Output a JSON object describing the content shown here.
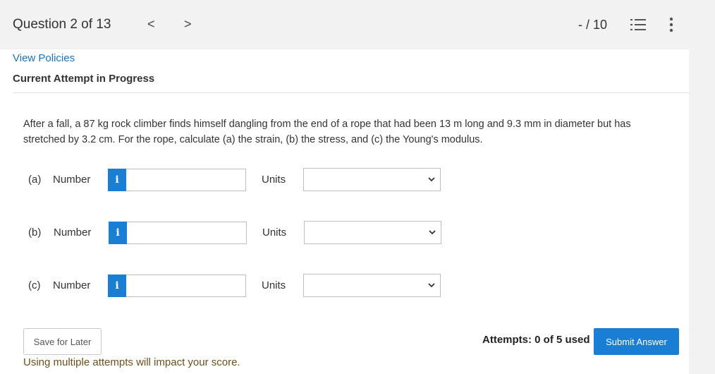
{
  "header": {
    "question_counter": "Question 2 of 13",
    "prev_label": "<",
    "next_label": ">",
    "score": "- / 10"
  },
  "links": {
    "view_policies": "View Policies"
  },
  "status": {
    "attempt": "Current Attempt in Progress"
  },
  "question": {
    "text": "After a fall, a 87 kg rock climber finds himself dangling from the end of a rope that had been 13 m long and 9.3 mm in diameter but has stretched by 3.2 cm. For the rope, calculate (a) the strain, (b) the stress, and (c) the Young's modulus."
  },
  "parts": [
    {
      "label": "(a)",
      "number_label": "Number",
      "info": "i",
      "value": "",
      "units_label": "Units",
      "units_value": ""
    },
    {
      "label": "(b)",
      "number_label": "Number",
      "info": "i",
      "value": "",
      "units_label": "Units",
      "units_value": ""
    },
    {
      "label": "(c)",
      "number_label": "Number",
      "info": "i",
      "value": "",
      "units_label": "Units",
      "units_value": ""
    }
  ],
  "footer": {
    "save_label": "Save for Later",
    "attempts": "Attempts: 0 of 5 used",
    "submit_label": "Submit Answer",
    "warning": "Using multiple attempts will impact your score."
  },
  "colors": {
    "accent": "#1a7fd4",
    "link": "#1a73b8",
    "warning": "#6b4f1c",
    "background": "#f2f2f2"
  },
  "icons": {
    "list": "numbered-list-icon",
    "more": "more-vertical-icon",
    "info": "info-icon",
    "dropdown": "chevron-down-icon"
  }
}
